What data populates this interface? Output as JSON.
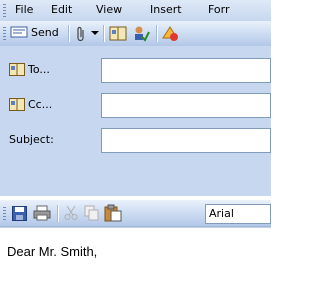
{
  "menu": {
    "file": "File",
    "edit": "Edit",
    "view": "View",
    "insert": "Insert",
    "format": "Forr"
  },
  "toolbar": {
    "send": "Send"
  },
  "fields": {
    "to": "To...",
    "cc": "Cc...",
    "subject": "Subject:"
  },
  "format": {
    "font": "Arial"
  },
  "body": {
    "text": "Dear Mr. Smith,"
  }
}
